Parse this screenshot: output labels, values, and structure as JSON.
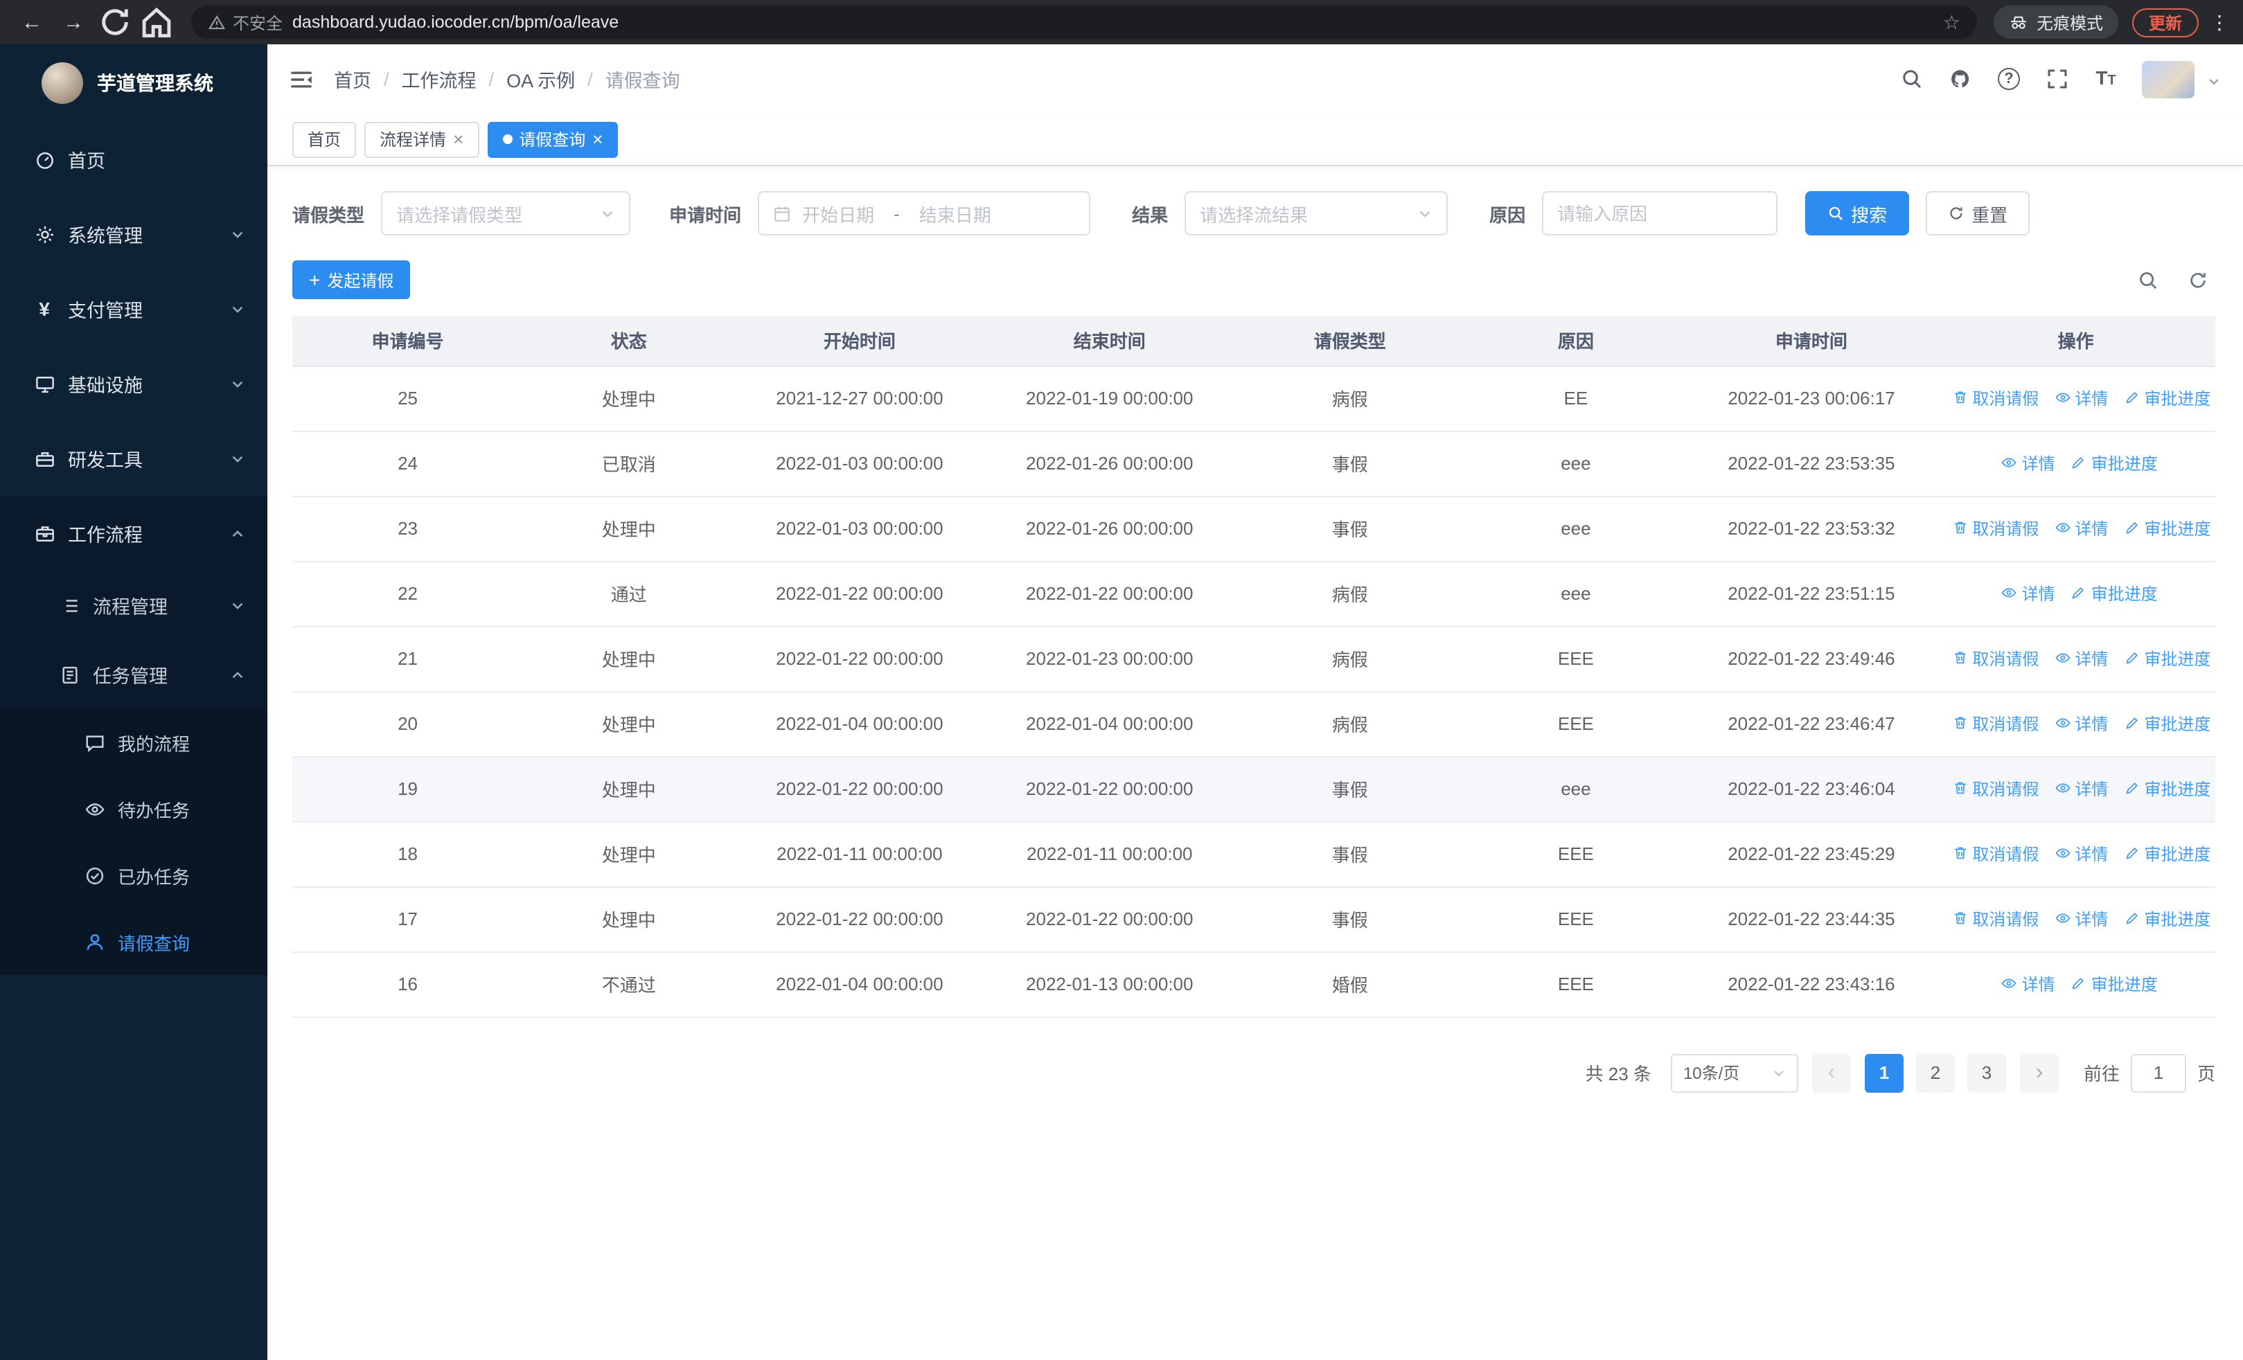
{
  "browser": {
    "security_warning": "不安全",
    "url": "dashboard.yudao.iocoder.cn/bpm/oa/leave",
    "incognito_label": "无痕模式",
    "update_label": "更新"
  },
  "sidebar": {
    "logo_title": "芋道管理系统",
    "items": [
      {
        "label": "首页"
      },
      {
        "label": "系统管理"
      },
      {
        "label": "支付管理"
      },
      {
        "label": "基础设施"
      },
      {
        "label": "研发工具"
      },
      {
        "label": "工作流程"
      }
    ],
    "workflow_children": [
      {
        "label": "流程管理"
      },
      {
        "label": "任务管理"
      }
    ],
    "task_children": [
      {
        "label": "我的流程"
      },
      {
        "label": "待办任务"
      },
      {
        "label": "已办任务"
      },
      {
        "label": "请假查询"
      }
    ]
  },
  "header": {
    "breadcrumb": [
      "首页",
      "工作流程",
      "OA 示例",
      "请假查询"
    ]
  },
  "tabs": [
    {
      "label": "首页"
    },
    {
      "label": "流程详情"
    },
    {
      "label": "请假查询"
    }
  ],
  "filters": {
    "leave_type_label": "请假类型",
    "leave_type_placeholder": "请选择请假类型",
    "apply_time_label": "申请时间",
    "start_date_placeholder": "开始日期",
    "date_separator": "-",
    "end_date_placeholder": "结束日期",
    "result_label": "结果",
    "result_placeholder": "请选择流结果",
    "reason_label": "原因",
    "reason_placeholder": "请输入原因",
    "search_button": "搜索",
    "reset_button": "重置"
  },
  "toolbar": {
    "create_button": "发起请假"
  },
  "table": {
    "columns": [
      "申请编号",
      "状态",
      "开始时间",
      "结束时间",
      "请假类型",
      "原因",
      "申请时间",
      "操作"
    ],
    "action_labels": {
      "cancel": "取消请假",
      "detail": "详情",
      "progress": "审批进度"
    },
    "rows": [
      {
        "id": "25",
        "status": "处理中",
        "start": "2021-12-27 00:00:00",
        "end": "2022-01-19 00:00:00",
        "type": "病假",
        "reason": "EE",
        "applied": "2022-01-23 00:06:17",
        "actions": [
          "cancel",
          "detail",
          "progress"
        ],
        "highlight": false
      },
      {
        "id": "24",
        "status": "已取消",
        "start": "2022-01-03 00:00:00",
        "end": "2022-01-26 00:00:00",
        "type": "事假",
        "reason": "eee",
        "applied": "2022-01-22 23:53:35",
        "actions": [
          "detail",
          "progress"
        ],
        "highlight": false
      },
      {
        "id": "23",
        "status": "处理中",
        "start": "2022-01-03 00:00:00",
        "end": "2022-01-26 00:00:00",
        "type": "事假",
        "reason": "eee",
        "applied": "2022-01-22 23:53:32",
        "actions": [
          "cancel",
          "detail",
          "progress"
        ],
        "highlight": false
      },
      {
        "id": "22",
        "status": "通过",
        "start": "2022-01-22 00:00:00",
        "end": "2022-01-22 00:00:00",
        "type": "病假",
        "reason": "eee",
        "applied": "2022-01-22 23:51:15",
        "actions": [
          "detail",
          "progress"
        ],
        "highlight": false
      },
      {
        "id": "21",
        "status": "处理中",
        "start": "2022-01-22 00:00:00",
        "end": "2022-01-23 00:00:00",
        "type": "病假",
        "reason": "EEE",
        "applied": "2022-01-22 23:49:46",
        "actions": [
          "cancel",
          "detail",
          "progress"
        ],
        "highlight": false
      },
      {
        "id": "20",
        "status": "处理中",
        "start": "2022-01-04 00:00:00",
        "end": "2022-01-04 00:00:00",
        "type": "病假",
        "reason": "EEE",
        "applied": "2022-01-22 23:46:47",
        "actions": [
          "cancel",
          "detail",
          "progress"
        ],
        "highlight": false
      },
      {
        "id": "19",
        "status": "处理中",
        "start": "2022-01-22 00:00:00",
        "end": "2022-01-22 00:00:00",
        "type": "事假",
        "reason": "eee",
        "applied": "2022-01-22 23:46:04",
        "actions": [
          "cancel",
          "detail",
          "progress"
        ],
        "highlight": true
      },
      {
        "id": "18",
        "status": "处理中",
        "start": "2022-01-11 00:00:00",
        "end": "2022-01-11 00:00:00",
        "type": "事假",
        "reason": "EEE",
        "applied": "2022-01-22 23:45:29",
        "actions": [
          "cancel",
          "detail",
          "progress"
        ],
        "highlight": false
      },
      {
        "id": "17",
        "status": "处理中",
        "start": "2022-01-22 00:00:00",
        "end": "2022-01-22 00:00:00",
        "type": "事假",
        "reason": "EEE",
        "applied": "2022-01-22 23:44:35",
        "actions": [
          "cancel",
          "detail",
          "progress"
        ],
        "highlight": false
      },
      {
        "id": "16",
        "status": "不通过",
        "start": "2022-01-04 00:00:00",
        "end": "2022-01-13 00:00:00",
        "type": "婚假",
        "reason": "EEE",
        "applied": "2022-01-22 23:43:16",
        "actions": [
          "detail",
          "progress"
        ],
        "highlight": false
      }
    ]
  },
  "pagination": {
    "total_text": "共 23 条",
    "page_size": "10条/页",
    "pages": [
      "1",
      "2",
      "3"
    ],
    "active_page": "1",
    "goto_label": "前往",
    "goto_value": "1",
    "goto_suffix": "页"
  }
}
